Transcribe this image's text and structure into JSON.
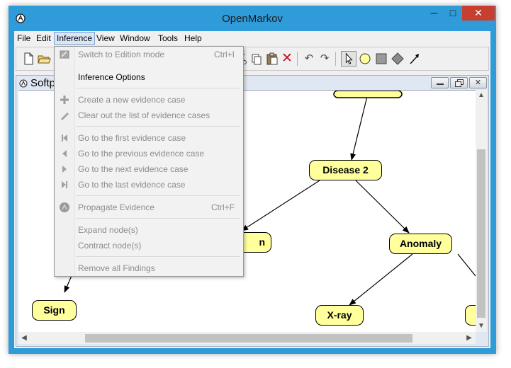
{
  "window": {
    "title": "OpenMarkov",
    "minimize_glyph": "─",
    "maximize_glyph": "□",
    "close_glyph": "✕"
  },
  "menubar": {
    "items": [
      "File",
      "Edit",
      "Inference",
      "View",
      "Window",
      "Tools",
      "Help"
    ],
    "active": "Inference"
  },
  "toolbar": {
    "buttons": [
      "new-file-icon",
      "open-folder-icon",
      "save-icon",
      "cut-icon",
      "copy-icon",
      "paste-icon",
      "delete-icon",
      "undo-icon",
      "redo-icon",
      "select-pointer-icon",
      "chance-node-icon",
      "decision-node-icon",
      "utility-node-icon",
      "link-arrow-icon"
    ],
    "delete_glyph": "✕",
    "undo_glyph": "↶",
    "redo_glyph": "↷"
  },
  "internal_frame": {
    "title": "Softp"
  },
  "inference_menu": {
    "items": [
      {
        "label": "Switch to Edition mode",
        "shortcut": "Ctrl+I",
        "enabled": false,
        "icon": "edition-mode-icon"
      },
      {
        "label": "Inference Options",
        "shortcut": "",
        "enabled": true,
        "icon": ""
      },
      {
        "label": "Create a new evidence case",
        "shortcut": "",
        "enabled": false,
        "icon": "plus-icon"
      },
      {
        "label": "Clear out the list of evidence cases",
        "shortcut": "",
        "enabled": false,
        "icon": "eraser-icon"
      },
      {
        "label": "Go to the first evidence case",
        "shortcut": "",
        "enabled": false,
        "icon": "first-icon"
      },
      {
        "label": "Go to the previous evidence case",
        "shortcut": "",
        "enabled": false,
        "icon": "previous-icon"
      },
      {
        "label": "Go to the next evidence case",
        "shortcut": "",
        "enabled": false,
        "icon": "next-icon"
      },
      {
        "label": "Go to the last evidence case",
        "shortcut": "",
        "enabled": false,
        "icon": "last-icon"
      },
      {
        "label": "Propagate Evidence",
        "shortcut": "Ctrl+F",
        "enabled": false,
        "icon": "propagate-icon"
      },
      {
        "label": "Expand node(s)",
        "shortcut": "",
        "enabled": false,
        "icon": ""
      },
      {
        "label": "Contract node(s)",
        "shortcut": "",
        "enabled": false,
        "icon": ""
      },
      {
        "label": "Remove all Findings",
        "shortcut": "",
        "enabled": false,
        "icon": ""
      }
    ]
  },
  "network": {
    "nodes": {
      "disease2": "Disease 2",
      "anomaly": "Anomaly",
      "sign": "Sign",
      "xray": "X-ray",
      "partial_left": "n"
    }
  },
  "colors": {
    "node_fill": "#ffff9c",
    "titlebar": "#2f9bd9",
    "close_button": "#c7402f",
    "menu_active": "#dae6f5"
  }
}
